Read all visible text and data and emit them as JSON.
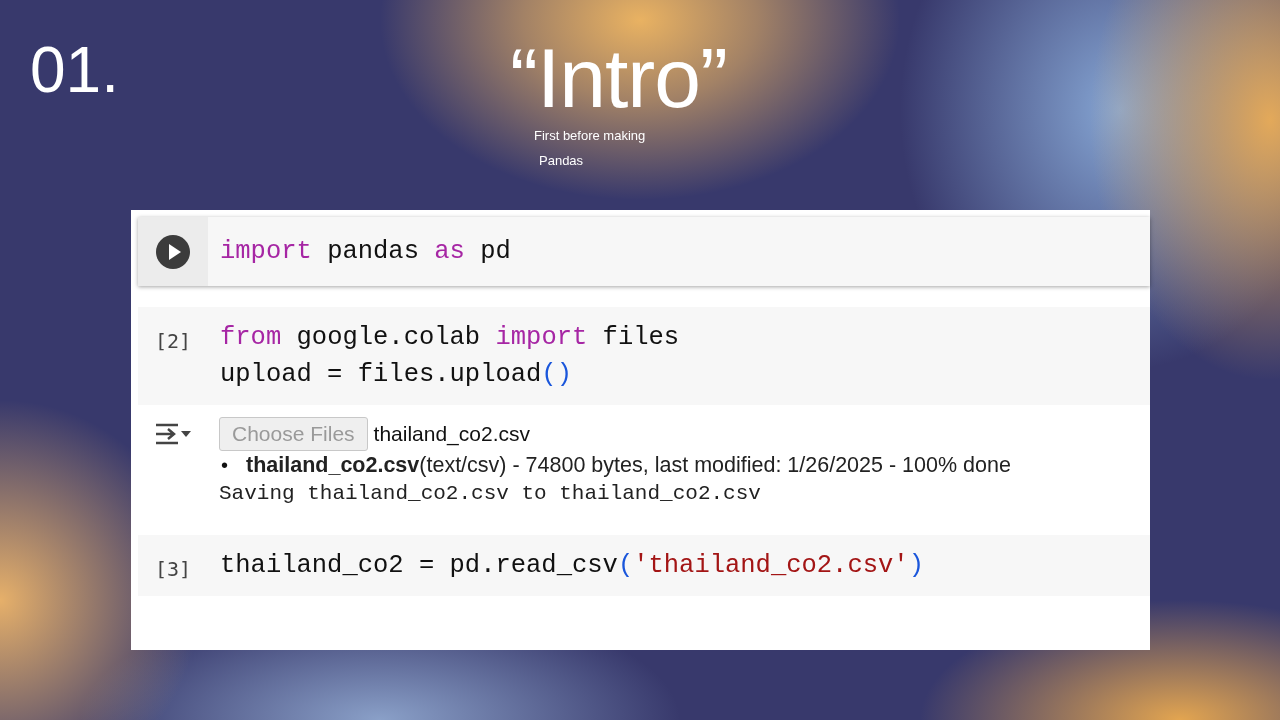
{
  "slide": {
    "number": "01.",
    "title": "“Intro”",
    "subtitle_lines": [
      "First before making",
      "Pandas"
    ]
  },
  "cells": [
    {
      "kind": "run",
      "lines": [
        [
          {
            "text": "import",
            "kind": "keyword"
          },
          {
            "text": " pandas ",
            "kind": "plain"
          },
          {
            "text": "as",
            "kind": "keyword"
          },
          {
            "text": " pd",
            "kind": "plain"
          }
        ]
      ]
    },
    {
      "kind": "done",
      "count": "[2]",
      "lines": [
        [
          {
            "text": "from",
            "kind": "keyword"
          },
          {
            "text": " google.colab ",
            "kind": "plain"
          },
          {
            "text": "import",
            "kind": "keyword"
          },
          {
            "text": " files",
            "kind": "plain"
          }
        ],
        [
          {
            "text": "upload = files.upload",
            "kind": "plain"
          },
          {
            "text": "()",
            "kind": "paren"
          }
        ]
      ],
      "output": {
        "files_button": "Choose Files",
        "file_name": "thailand_co2.csv",
        "items": [
          {
            "bullet": "•",
            "text": "**thailand_co2.csv**(text/csv) - 74800 bytes, last modified: 1/26/2025 - 100% done"
          }
        ],
        "log": "Saving thailand_co2.csv to thailand_co2.csv"
      }
    },
    {
      "kind": "done",
      "count": "[3]",
      "lines": [
        [
          {
            "text": "thailand_co2 = pd.read_csv",
            "kind": "plain"
          },
          {
            "text": "(",
            "kind": "paren"
          },
          {
            "text": "'thailand_co2.csv'",
            "kind": "string"
          },
          {
            "text": ")",
            "kind": "paren"
          }
        ]
      ]
    }
  ]
}
